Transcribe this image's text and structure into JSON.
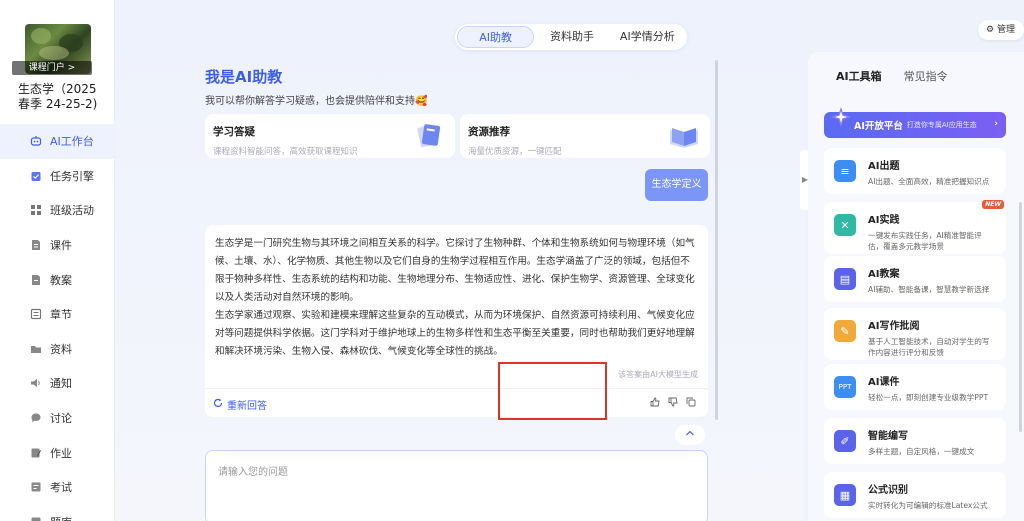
{
  "sidebar": {
    "course_link": "课程门户 >",
    "course_title": "生态学（2025春季 24-25-2)",
    "items": [
      {
        "label": "AI工作台",
        "icon": "robot-icon"
      },
      {
        "label": "任务引擎",
        "icon": "task-icon"
      },
      {
        "label": "班级活动",
        "icon": "grid-icon"
      },
      {
        "label": "课件",
        "icon": "courseware-icon"
      },
      {
        "label": "教案",
        "icon": "lesson-plan-icon"
      },
      {
        "label": "章节",
        "icon": "chapter-icon"
      },
      {
        "label": "资料",
        "icon": "folder-icon"
      },
      {
        "label": "通知",
        "icon": "speaker-icon"
      },
      {
        "label": "讨论",
        "icon": "chat-icon"
      },
      {
        "label": "作业",
        "icon": "homework-icon"
      },
      {
        "label": "考试",
        "icon": "exam-icon"
      },
      {
        "label": "题库",
        "icon": "question-bank-icon"
      }
    ]
  },
  "tabs": [
    "AI助教",
    "资料助手",
    "AI学情分析"
  ],
  "hero": {
    "title": "我是AI助教",
    "subtitle": "我可以帮你解答学习疑惑，也会提供陪伴和支持🥰"
  },
  "cards": [
    {
      "title": "学习答疑",
      "desc": "课程资料智能问答，高效获取课程知识"
    },
    {
      "title": "资源推荐",
      "desc": "海量优质资源，一键匹配"
    }
  ],
  "user_message": "生态学定义",
  "answer": {
    "paragraph1": "生态学是一门研究生物与其环境之间相互关系的科学。它探讨了生物种群、个体和生物系统如何与物理环境（如气候、土壤、水）、化学物质、其他生物以及它们自身的生物学过程相互作用。生态学涵盖了广泛的领域，包括但不限于物种多样性、生态系统的结构和功能、生物地理分布、生物适应性、进化、保护生物学、资源管理、全球变化以及人类活动对自然环境的影响。",
    "paragraph2": "生态学家通过观察、实验和建模来理解这些复杂的互动模式，从而为环境保护、自然资源可持续利用、气候变化应对等问题提供科学依据。这门学科对于维护地球上的生物多样性和生态平衡至关重要，同时也帮助我们更好地理解和解决环境污染、生物入侵、森林砍伐、气候变化等全球性的挑战。",
    "generated_note": "该答案由AI大模型生成",
    "regenerate": "重新回答"
  },
  "input": {
    "placeholder": "请输入您的问题"
  },
  "right": {
    "manage": "管理",
    "tabs": [
      "AI工具箱",
      "常见指令"
    ],
    "open_platform": {
      "title": "AI开放平台",
      "subtitle": "打造你专属AI应用生态"
    },
    "tools": [
      {
        "name": "AI出题",
        "desc": "AI出题、全面高效，精准把握知识点",
        "icon": "quiz-icon",
        "color": "#3d8ef0"
      },
      {
        "name": "AI实践",
        "desc": "一键发布实践任务，AI精准智能评估，覆盖多元教学场景",
        "icon": "practice-icon",
        "color": "#2fb8a4",
        "badge": "NEW"
      },
      {
        "name": "AI教案",
        "desc": "AI辅助、智能备课，智慧教学新选择",
        "icon": "lesson-plan-icon",
        "color": "#5b63e8"
      },
      {
        "name": "AI写作批阅",
        "desc": "基于人工智能技术，自动对学生的写作内容进行评分和反馈",
        "icon": "writing-icon",
        "color": "#f0a93b"
      },
      {
        "name": "AI课件",
        "desc": "轻松一点，即刻创建专业级教学PPT",
        "icon": "ppt-icon",
        "color": "#3d8ef0"
      },
      {
        "name": "智能编写",
        "desc": "多样主题，自定风格，一键成文",
        "icon": "compose-icon",
        "color": "#5b63e8"
      },
      {
        "name": "公式识别",
        "desc": "实时转化为可编辑的标准Latex公式",
        "icon": "formula-icon",
        "color": "#5b63e8"
      }
    ]
  }
}
